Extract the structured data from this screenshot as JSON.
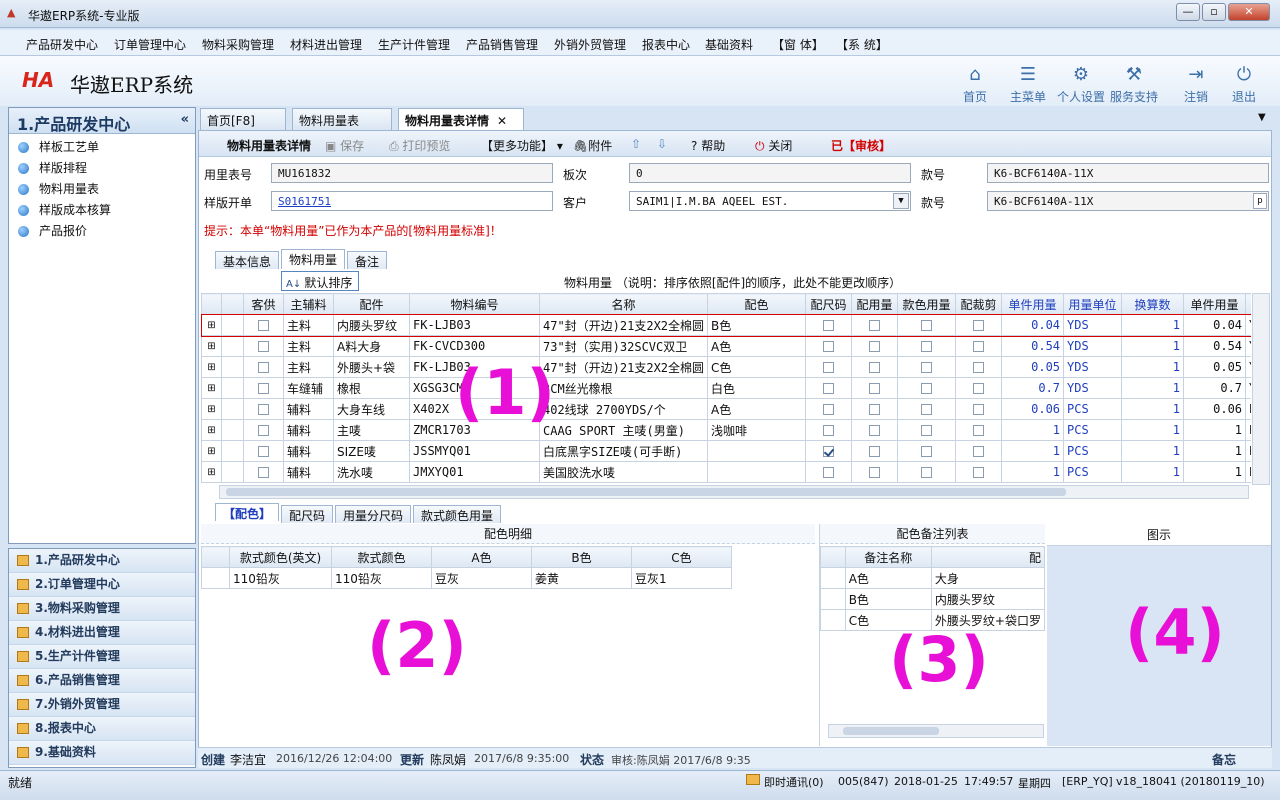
{
  "window": {
    "title": "华遨ERP系统-专业版",
    "min": "—",
    "max": "▫",
    "close": "✕"
  },
  "menu": [
    "产品研发中心",
    "订单管理中心",
    "物料采购管理",
    "材料进出管理",
    "生产计件管理",
    "产品销售管理",
    "外销外贸管理",
    "报表中心",
    "基础资料",
    "【窗 体】",
    "【系 统】"
  ],
  "brand": {
    "logo": "HA",
    "name": "华遨ERP系统"
  },
  "toolbar": [
    {
      "icon": "home-icon",
      "label": "首页"
    },
    {
      "icon": "list-icon",
      "label": "主菜单"
    },
    {
      "icon": "gear-icon",
      "label": "个人设置"
    },
    {
      "icon": "service-icon",
      "label": "服务支持"
    },
    {
      "icon": "logout-icon",
      "label": "注销"
    },
    {
      "icon": "power-icon",
      "label": "退出"
    }
  ],
  "left": {
    "title": "1.产品研发中心",
    "items": [
      "样板工艺单",
      "样版排程",
      "物料用量表",
      "样版成本核算",
      "产品报价"
    ]
  },
  "nav": [
    "1.产品研发中心",
    "2.订单管理中心",
    "3.物料采购管理",
    "4.材料进出管理",
    "5.生产计件管理",
    "6.产品销售管理",
    "7.外销外贸管理",
    "8.报表中心",
    "9.基础资料"
  ],
  "tabs": [
    "首页[F8]",
    "物料用量表",
    "物料用量表详情"
  ],
  "doc_toolbar": {
    "title": "物料用量表详情",
    "save": "保存",
    "print": "打印预览",
    "more": "【更多功能】",
    "attach": "附件",
    "help": "帮助",
    "close": "关闭",
    "audit": "已【审核】"
  },
  "form": {
    "l1": "用里表号",
    "v1": "MU161832",
    "l2": "板次",
    "v2": "0",
    "l3": "款号",
    "v3": "K6-BCF6140A-11X",
    "l4": "样版开单",
    "v4": "S0161751",
    "l5": "客户",
    "v5": "SAIM1|I.M.BA AQEEL EST.",
    "l6": "款号",
    "v6": "K6-BCF6140A-11X"
  },
  "hint": "提示：本单“物料用量”已作为本产品的[物料用量标准]！",
  "subtabs": [
    "基本信息",
    "物料用量",
    "备注"
  ],
  "sort_label": "默认排序",
  "grid_caption": "物料用量  （说明：排序依照[配件]的顺序，此处不能更改顺序）",
  "grid": {
    "cols": [
      "客供",
      "主辅料",
      "配件",
      "物料编号",
      "名称",
      "配色",
      "配尺码",
      "配用量",
      "款色用量",
      "配裁剪",
      "单件用量",
      "用量单位",
      "换算数",
      "单件用量"
    ],
    "rows": [
      {
        "c1": "主料",
        "c2": "内腰头罗纹",
        "c3": "FK-LJB03",
        "c4": "47\"封（开边)21支2X2全棉圆",
        "c5": "B色",
        "cb": false,
        "q": "0.04",
        "u": "YDS",
        "n": "1",
        "q2": "0.04",
        "t": "Y"
      },
      {
        "c1": "主料",
        "c2": "A料大身",
        "c3": "FK-CVCD300",
        "c4": "73\"封（实用)32SCVC双卫",
        "c5": "A色",
        "cb": false,
        "q": "0.54",
        "u": "YDS",
        "n": "1",
        "q2": "0.54",
        "t": "Y"
      },
      {
        "c1": "主料",
        "c2": "外腰头+袋",
        "c3": "FK-LJB03",
        "c4": "47\"封（开边)21支2X2全棉圆",
        "c5": "C色",
        "cb": false,
        "q": "0.05",
        "u": "YDS",
        "n": "1",
        "q2": "0.05",
        "t": "Y"
      },
      {
        "c1": "车缝辅",
        "c2": "橡根",
        "c3": "XGSG3CM",
        "c4": "3CM丝光橡根",
        "c5": "白色",
        "cb": false,
        "q": "0.7",
        "u": "YDS",
        "n": "1",
        "q2": "0.7",
        "t": "Y"
      },
      {
        "c1": "辅料",
        "c2": "大身车线",
        "c3": "X402X",
        "c4": "402线球 2700YDS/个",
        "c5": "A色",
        "cb": false,
        "q": "0.06",
        "u": "PCS",
        "n": "1",
        "q2": "0.06",
        "t": "P"
      },
      {
        "c1": "辅料",
        "c2": "主唛",
        "c3": "ZMCR1703",
        "c4": "CAAG SPORT 主唛(男童)",
        "c5": "浅咖啡",
        "cb": false,
        "q": "1",
        "u": "PCS",
        "n": "1",
        "q2": "1",
        "t": "P"
      },
      {
        "c1": "辅料",
        "c2": "SIZE唛",
        "c3": "JSSMYQ01",
        "c4": "白底黑字SIZE唛(可手断)",
        "c5": "",
        "cb": true,
        "q": "1",
        "u": "PCS",
        "n": "1",
        "q2": "1",
        "t": "P"
      },
      {
        "c1": "辅料",
        "c2": "洗水唛",
        "c3": "JMXYQ01",
        "c4": "美国胶洗水唛",
        "c5": "",
        "cb": false,
        "q": "1",
        "u": "PCS",
        "n": "1",
        "q2": "1",
        "t": "P"
      }
    ]
  },
  "lower_tabs": [
    "【配色】",
    "配尺码",
    "用量分尺码",
    "款式颜色用量"
  ],
  "color_detail": {
    "title": "配色明细",
    "cols": [
      "款式颜色(英文)",
      "款式颜色",
      "A色",
      "B色",
      "C色"
    ],
    "row": [
      "110铅灰",
      "110铅灰",
      "豆灰",
      "姜黄",
      "豆灰1"
    ]
  },
  "color_notes": {
    "title": "配色备注列表",
    "cols": [
      "备注名称",
      "配"
    ],
    "rows": [
      [
        "A色",
        "大身"
      ],
      [
        "B色",
        "内腰头罗纹"
      ],
      [
        "C色",
        "外腰头罗纹+袋口罗"
      ]
    ]
  },
  "diagram": {
    "title": "图示"
  },
  "overlays": [
    "(1)",
    "(2)",
    "(3)",
    "(4)"
  ],
  "audit": {
    "create_l": "创建",
    "create_u": "李洁宜",
    "create_t": "2016/12/26 12:04:00",
    "upd_l": "更新",
    "upd_u": "陈凤娟",
    "upd_t": "2017/6/8 9:35:00",
    "st_l": "状态",
    "st_v": "审核:陈凤娟 2017/6/8 9:35",
    "memo": "备忘"
  },
  "status": {
    "left": "就绪",
    "im": "即时通讯(0)",
    "user": "005(847)",
    "date": "2018-01-25",
    "time": "17:49:57",
    "weekday": "星期四",
    "sys": "[ERP_YQ]",
    "ver": "v18_18041 (20180119_10)"
  },
  "colors": {
    "accent": "#1f3fbf",
    "red": "#d40000",
    "overlay": "#e810d6"
  }
}
